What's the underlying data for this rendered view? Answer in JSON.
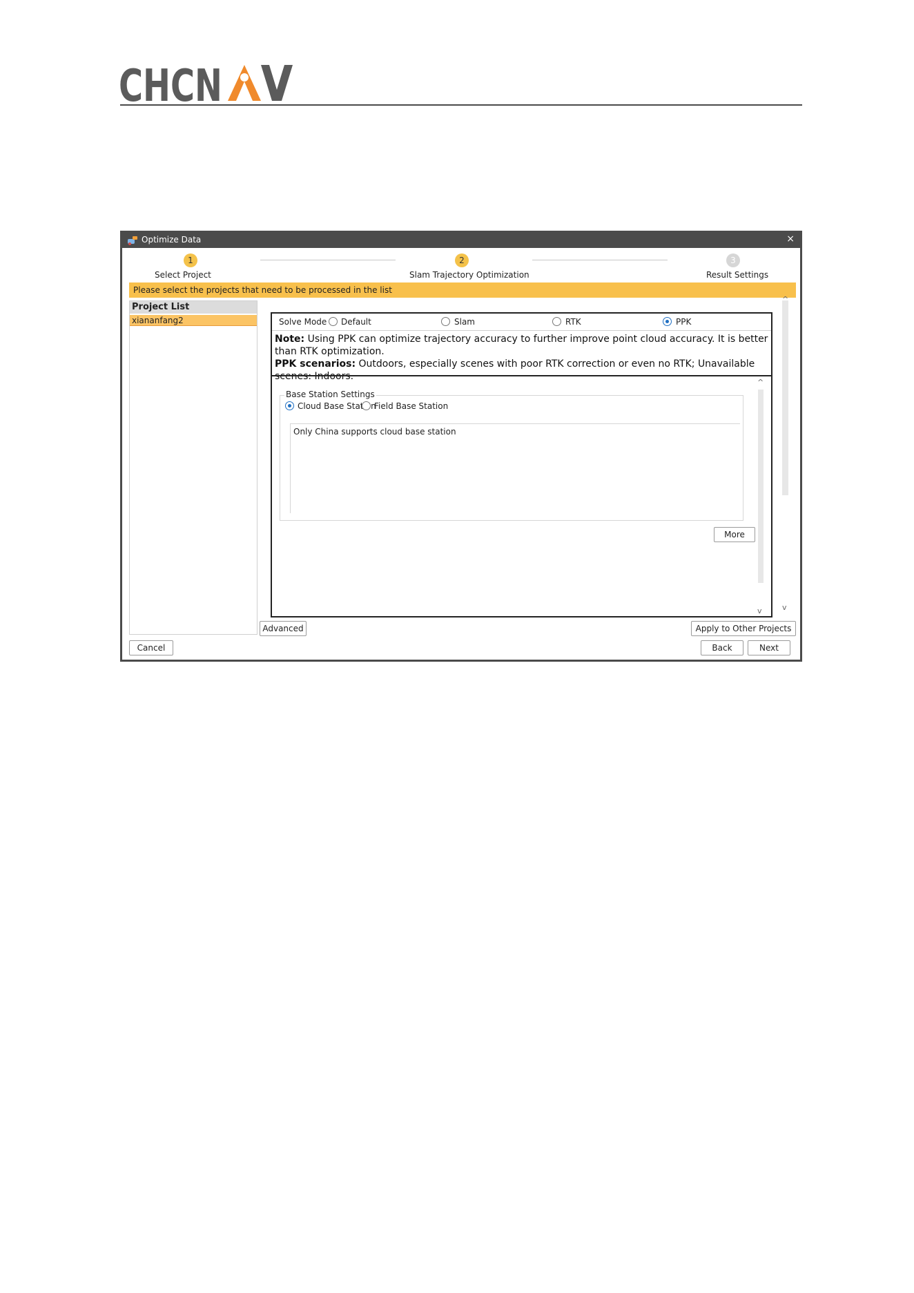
{
  "brand": {
    "logo_text": "CHCNAV",
    "dark_color": "#5b5b5b",
    "accent_color": "#f08a2c"
  },
  "window": {
    "title": "Optimize Data",
    "close_label": "×"
  },
  "steps": [
    {
      "number": "1",
      "label": "Select Project",
      "state": "done"
    },
    {
      "number": "2",
      "label": "Slam Trajectory Optimization",
      "state": "current"
    },
    {
      "number": "3",
      "label": "Result Settings",
      "state": "pending"
    }
  ],
  "info_message": "Please select the projects that need to be processed in the list",
  "project_list": {
    "header": "Project List",
    "items": [
      "xiananfang2"
    ]
  },
  "solve_mode": {
    "label": "Solve Mode",
    "options": [
      "Default",
      "Slam",
      "RTK",
      "PPK"
    ],
    "selected": "PPK"
  },
  "note": {
    "note_label": "Note:",
    "note_text": " Using PPK can optimize trajectory accuracy to further improve point cloud accuracy. It is better than RTK optimization.",
    "scenarios_label": "PPK scenarios:",
    "scenarios_text": " Outdoors, especially scenes with poor RTK correction or even no RTK; Unavailable scenes: Indoors."
  },
  "base_station": {
    "group_title": "Base Station Settings",
    "options": [
      "Cloud Base Station",
      "Field Base Station"
    ],
    "selected": "Cloud Base Station",
    "cloud_note": "Only China supports cloud base station",
    "more_label": "More"
  },
  "buttons": {
    "advanced": "Advanced",
    "apply_other": "Apply to Other Projects",
    "cancel": "Cancel",
    "back": "Back",
    "next": "Next"
  },
  "scroll": {
    "up": "^",
    "down": "v"
  }
}
